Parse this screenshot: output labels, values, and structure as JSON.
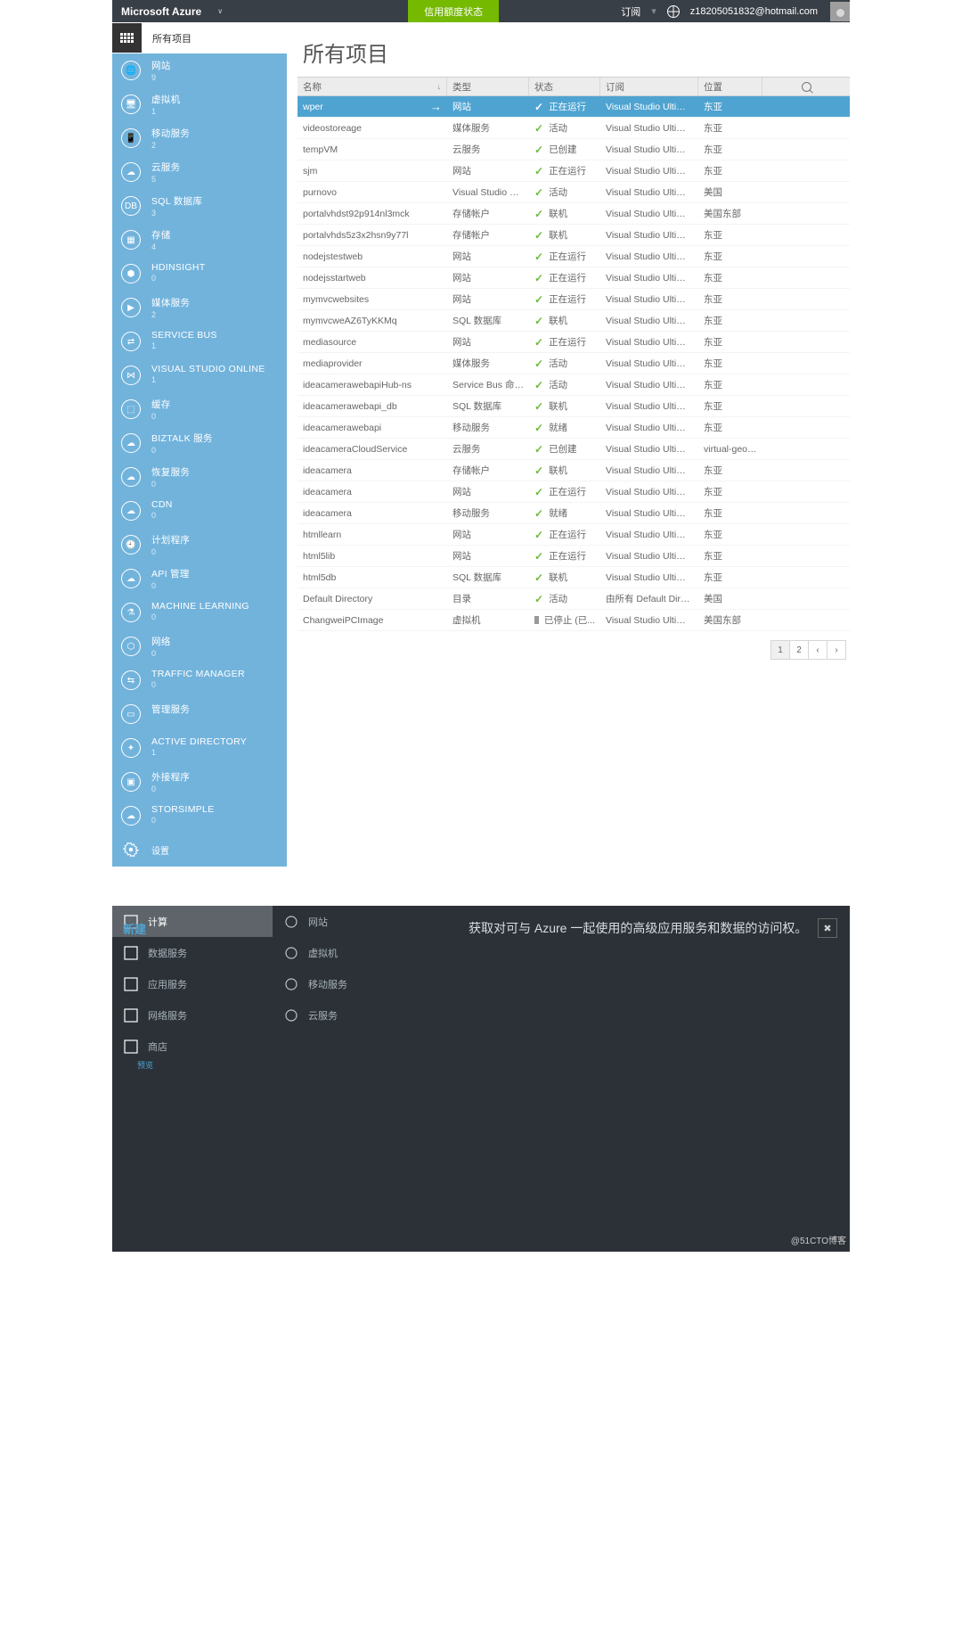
{
  "topbar": {
    "brand": "Microsoft Azure",
    "credit": "信用额度状态",
    "sub": "订阅",
    "email": "z18205051832@hotmail.com"
  },
  "sidebar": {
    "header": "所有项目",
    "items": [
      {
        "name": "网站",
        "count": "9"
      },
      {
        "name": "虚拟机",
        "count": "1"
      },
      {
        "name": "移动服务",
        "count": "2"
      },
      {
        "name": "云服务",
        "count": "5"
      },
      {
        "name": "SQL 数据库",
        "count": "3"
      },
      {
        "name": "存储",
        "count": "4"
      },
      {
        "name": "HDINSIGHT",
        "count": "0"
      },
      {
        "name": "媒体服务",
        "count": "2"
      },
      {
        "name": "SERVICE BUS",
        "count": "1"
      },
      {
        "name": "VISUAL STUDIO ONLINE",
        "count": "1"
      },
      {
        "name": "缓存",
        "count": "0"
      },
      {
        "name": "BIZTALK 服务",
        "count": "0"
      },
      {
        "name": "恢复服务",
        "count": "0"
      },
      {
        "name": "CDN",
        "count": "0"
      },
      {
        "name": "计划程序",
        "count": "0"
      },
      {
        "name": "API 管理",
        "count": "0"
      },
      {
        "name": "MACHINE LEARNING",
        "count": "0"
      },
      {
        "name": "网络",
        "count": "0"
      },
      {
        "name": "TRAFFIC MANAGER",
        "count": "0"
      },
      {
        "name": "管理服务",
        "count": ""
      },
      {
        "name": "ACTIVE DIRECTORY",
        "count": "1"
      },
      {
        "name": "外接程序",
        "count": "0"
      },
      {
        "name": "STORSIMPLE",
        "count": "0"
      }
    ],
    "settings": "设置"
  },
  "page": {
    "title": "所有项目",
    "cols": {
      "name": "名称",
      "type": "类型",
      "status": "状态",
      "sub": "订阅",
      "loc": "位置"
    }
  },
  "rows": [
    {
      "n": "wper",
      "t": "网站",
      "s": "正在运行",
      "sub": "Visual Studio Ultimate wi...",
      "l": "东亚",
      "sel": true,
      "ok": true
    },
    {
      "n": "videostoreage",
      "t": "媒体服务",
      "s": "活动",
      "sub": "Visual Studio Ultimate wi...",
      "l": "东亚",
      "ok": true
    },
    {
      "n": "tempVM",
      "t": "云服务",
      "s": "已创建",
      "sub": "Visual Studio Ultimate wi...",
      "l": "东亚",
      "ok": true
    },
    {
      "n": "sjm",
      "t": "网站",
      "s": "正在运行",
      "sub": "Visual Studio Ultimate wi...",
      "l": "东亚",
      "ok": true
    },
    {
      "n": "purnovo",
      "t": "Visual Studio Online",
      "s": "活动",
      "sub": "Visual Studio Ultimate wi...",
      "l": "美国",
      "ok": true
    },
    {
      "n": "portalvhdst92p914nl3mck",
      "t": "存储帐户",
      "s": "联机",
      "sub": "Visual Studio Ultimate wi...",
      "l": "美国东部",
      "ok": true
    },
    {
      "n": "portalvhds5z3x2hsn9y77l",
      "t": "存储帐户",
      "s": "联机",
      "sub": "Visual Studio Ultimate wi...",
      "l": "东亚",
      "ok": true
    },
    {
      "n": "nodejstestweb",
      "t": "网站",
      "s": "正在运行",
      "sub": "Visual Studio Ultimate wi...",
      "l": "东亚",
      "ok": true
    },
    {
      "n": "nodejsstartweb",
      "t": "网站",
      "s": "正在运行",
      "sub": "Visual Studio Ultimate wi...",
      "l": "东亚",
      "ok": true
    },
    {
      "n": "mymvcwebsites",
      "t": "网站",
      "s": "正在运行",
      "sub": "Visual Studio Ultimate wi...",
      "l": "东亚",
      "ok": true
    },
    {
      "n": "mymvcweAZ6TyKKMq",
      "t": "SQL 数据库",
      "s": "联机",
      "sub": "Visual Studio Ultimate wi...",
      "l": "东亚",
      "ok": true
    },
    {
      "n": "mediasource",
      "t": "网站",
      "s": "正在运行",
      "sub": "Visual Studio Ultimate wi...",
      "l": "东亚",
      "ok": true
    },
    {
      "n": "mediaprovider",
      "t": "媒体服务",
      "s": "活动",
      "sub": "Visual Studio Ultimate wi...",
      "l": "东亚",
      "ok": true
    },
    {
      "n": "ideacamerawebapiHub-ns",
      "t": "Service Bus 命名空间",
      "s": "活动",
      "sub": "Visual Studio Ultimate wi...",
      "l": "东亚",
      "ok": true
    },
    {
      "n": "ideacamerawebapi_db",
      "t": "SQL 数据库",
      "s": "联机",
      "sub": "Visual Studio Ultimate wi...",
      "l": "东亚",
      "ok": true
    },
    {
      "n": "ideacamerawebapi",
      "t": "移动服务",
      "s": "就绪",
      "sub": "Visual Studio Ultimate wi...",
      "l": "东亚",
      "ok": true
    },
    {
      "n": "ideacameraCloudService",
      "t": "云服务",
      "s": "已创建",
      "sub": "Visual Studio Ultimate wi...",
      "l": "virtual-geo-eastasia (...",
      "ok": true
    },
    {
      "n": "ideacamera",
      "t": "存储帐户",
      "s": "联机",
      "sub": "Visual Studio Ultimate wi...",
      "l": "东亚",
      "ok": true
    },
    {
      "n": "ideacamera",
      "t": "网站",
      "s": "正在运行",
      "sub": "Visual Studio Ultimate wi...",
      "l": "东亚",
      "ok": true
    },
    {
      "n": "ideacamera",
      "t": "移动服务",
      "s": "就绪",
      "sub": "Visual Studio Ultimate wi...",
      "l": "东亚",
      "ok": true
    },
    {
      "n": "htmllearn",
      "t": "网站",
      "s": "正在运行",
      "sub": "Visual Studio Ultimate wi...",
      "l": "东亚",
      "ok": true
    },
    {
      "n": "html5lib",
      "t": "网站",
      "s": "正在运行",
      "sub": "Visual Studio Ultimate wi...",
      "l": "东亚",
      "ok": true
    },
    {
      "n": "html5db",
      "t": "SQL 数据库",
      "s": "联机",
      "sub": "Visual Studio Ultimate wi...",
      "l": "东亚",
      "ok": true
    },
    {
      "n": "Default Directory",
      "t": "目录",
      "s": "活动",
      "sub": "由所有 Default Directory...",
      "l": "美国",
      "ok": true
    },
    {
      "n": "ChangweiPCImage",
      "t": "虚拟机",
      "s": "已停止 (已...",
      "sub": "Visual Studio Ultimate wi...",
      "l": "美国东部",
      "ok": false
    }
  ],
  "pager": {
    "p1": "1",
    "p2": "2",
    "prev": "‹",
    "next": "›"
  },
  "bottom": {
    "new": "新建",
    "col1": [
      {
        "label": "计算"
      },
      {
        "label": "数据服务"
      },
      {
        "label": "应用服务"
      },
      {
        "label": "网络服务"
      },
      {
        "label": "商店",
        "tag": "预览"
      }
    ],
    "col2": [
      {
        "label": "网站"
      },
      {
        "label": "虚拟机"
      },
      {
        "label": "移动服务"
      },
      {
        "label": "云服务"
      }
    ],
    "desc": "获取对可与 Azure 一起使用的高级应用服务和数据的访问权。"
  },
  "watermark": "@51CTO博客"
}
